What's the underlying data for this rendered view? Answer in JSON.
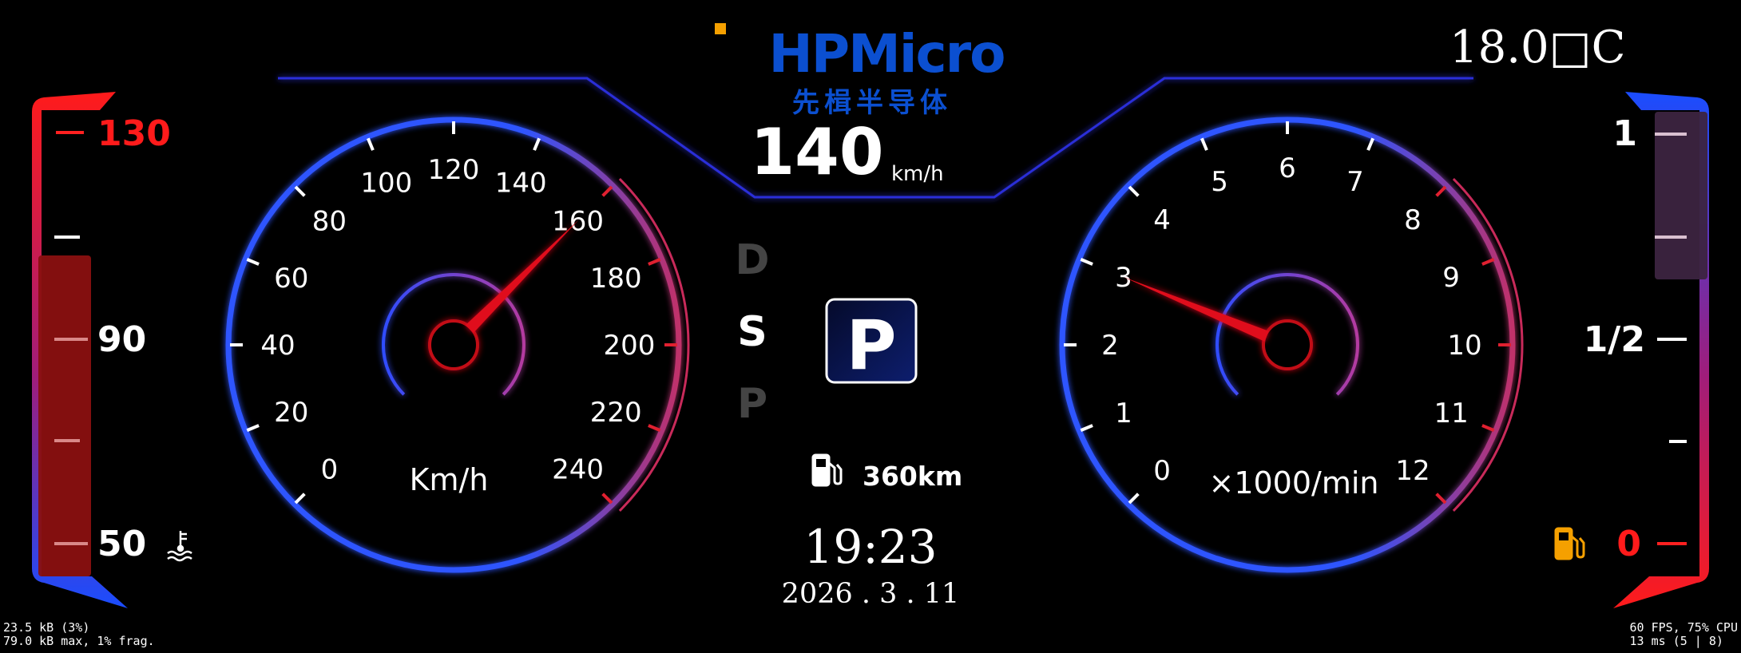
{
  "brand": {
    "name": "HPMicro",
    "subtitle": "先楫半导体",
    "accent": "#0b4fd0",
    "square": "#f5a000"
  },
  "temperature": "18.0□C",
  "center": {
    "speed_value": "140",
    "speed_unit": "km/h",
    "gears": [
      "D",
      "S",
      "P"
    ],
    "active_gear": "S",
    "park_letter": "P",
    "range": "360km",
    "time": "19:23",
    "date": "2026 . 3 . 11"
  },
  "speedometer": {
    "unit_label": "Km/h",
    "ticks": [
      "0",
      "20",
      "40",
      "60",
      "80",
      "100",
      "120",
      "140",
      "160",
      "180",
      "200",
      "220",
      "240"
    ],
    "min": 0,
    "max": 240,
    "value": 160,
    "redline_from": 160
  },
  "tachometer": {
    "unit_label": "×1000/min",
    "ticks": [
      "0",
      "1",
      "2",
      "3",
      "4",
      "5",
      "6",
      "7",
      "8",
      "9",
      "10",
      "11",
      "12"
    ],
    "min": 0,
    "max": 12,
    "value": 3,
    "redline_from": 8
  },
  "coolant_gauge": {
    "labels": {
      "top": "130",
      "mid": "90",
      "bottom": "50"
    },
    "icon": "coolant-temperature-icon",
    "level": 0.78,
    "colors": {
      "hot": "#ff1b1b",
      "cold": "#1a4dff"
    }
  },
  "fuel_gauge": {
    "labels": {
      "top": "1",
      "mid": "1/2",
      "bottom": "0"
    },
    "icon": "fuel-pump-icon",
    "level": 0.35,
    "colors": {
      "full": "#1a4dff",
      "empty": "#ff1b1b",
      "icon": "#f5a000"
    }
  },
  "debug": {
    "mem_line1": "23.5 kB (3%)",
    "mem_line2": "79.0 kB max, 1% frag.",
    "perf_line1": "60 FPS, 75% CPU",
    "perf_line2": "13 ms (5 | 8)"
  }
}
